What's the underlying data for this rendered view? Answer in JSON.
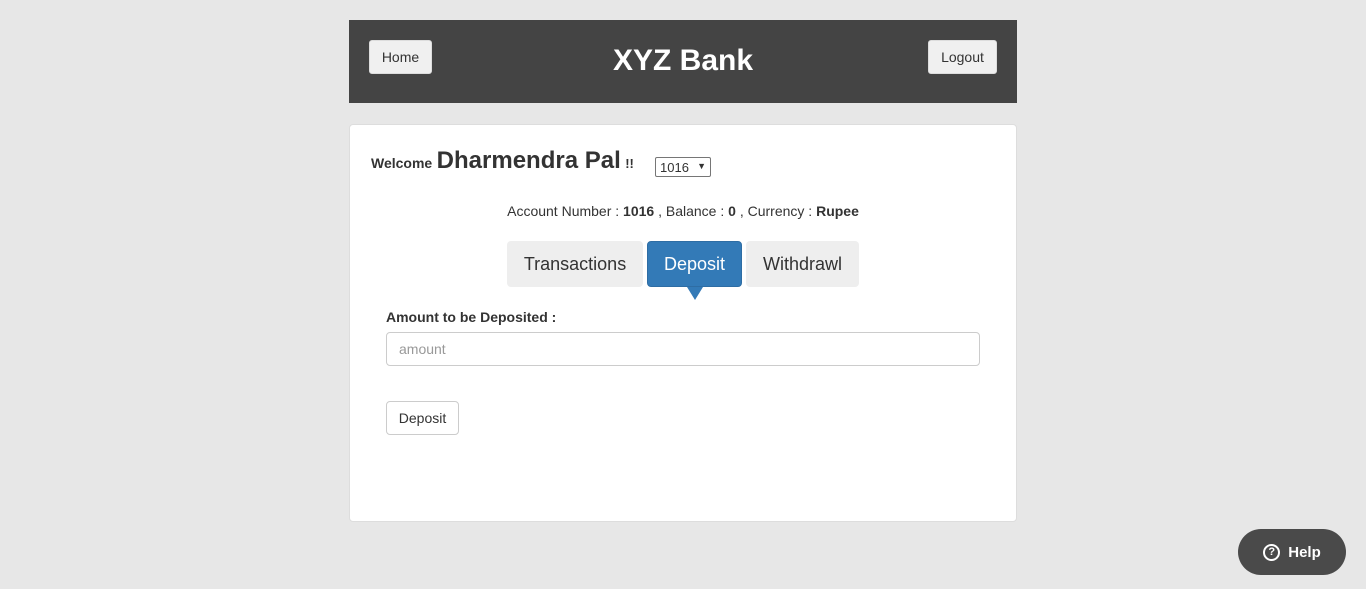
{
  "header": {
    "home_label": "Home",
    "title": "XYZ Bank",
    "logout_label": "Logout"
  },
  "welcome": {
    "prefix": "Welcome",
    "customer_name": "Dharmendra Pal",
    "suffix": "!!",
    "account_select": {
      "selected": "1016"
    }
  },
  "account_info": {
    "number_label": "Account Number : ",
    "number_value": "1016",
    "balance_label": " , Balance : ",
    "balance_value": "0",
    "currency_label": " , Currency : ",
    "currency_value": "Rupee"
  },
  "tabs": [
    {
      "label": "Transactions",
      "active": false
    },
    {
      "label": "Deposit",
      "active": true
    },
    {
      "label": "Withdrawl",
      "active": false
    }
  ],
  "deposit_form": {
    "amount_label": "Amount to be Deposited :",
    "amount_placeholder": "amount",
    "amount_value": "",
    "submit_label": "Deposit"
  },
  "help": {
    "label": "Help",
    "icon": "question-circle-icon"
  },
  "colors": {
    "header_bg": "#444444",
    "active_tab": "#337ab7",
    "page_bg": "#e7e7e7",
    "help_bg": "#4a4a4a"
  }
}
